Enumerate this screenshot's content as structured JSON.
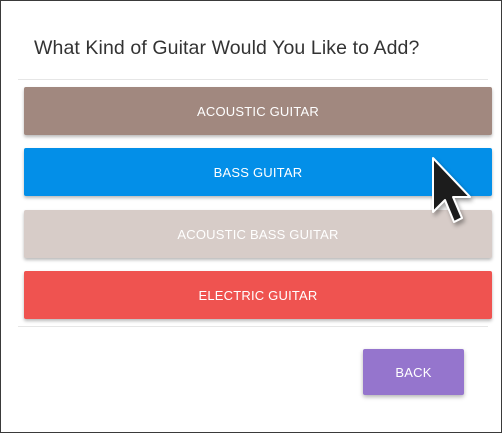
{
  "dialog": {
    "title": "What Kind of Guitar Would You Like to Add?"
  },
  "choices": [
    {
      "label": "ACOUSTIC GUITAR",
      "color": "#a1887f"
    },
    {
      "label": "BASS GUITAR",
      "color": "#038fe8"
    },
    {
      "label": "ACOUSTIC BASS GUITAR",
      "color": "#d7ccc8"
    },
    {
      "label": "ELECTRIC GUITAR",
      "color": "#ef5350"
    }
  ],
  "footer": {
    "back_label": "BACK",
    "back_color": "#9575cd"
  },
  "cursor": {
    "icon": "mouse-pointer-icon"
  }
}
